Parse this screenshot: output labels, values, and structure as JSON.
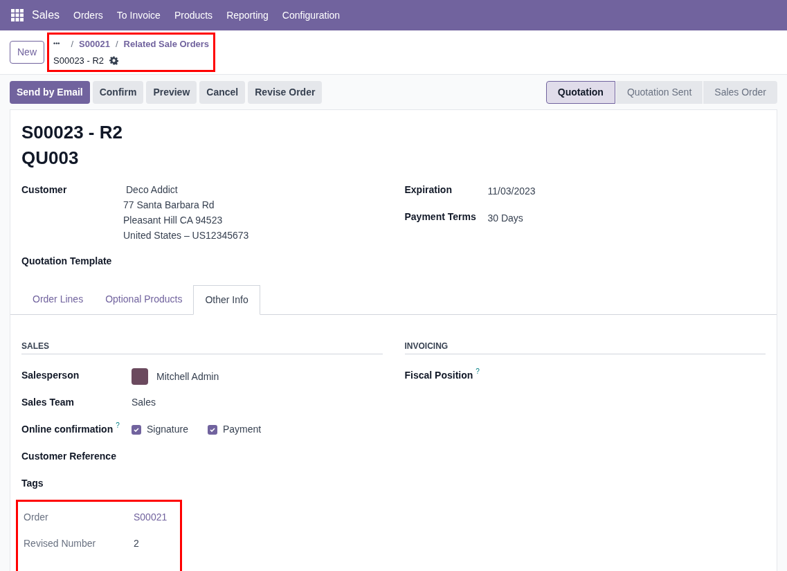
{
  "navbar": {
    "app": "Sales",
    "menu": [
      "Orders",
      "To Invoice",
      "Products",
      "Reporting",
      "Configuration"
    ]
  },
  "control_panel": {
    "new_button": "New",
    "annotated": true,
    "separator": "/",
    "breadcrumbs": [
      "•••",
      "S00021",
      "Related Sale Orders"
    ],
    "current": "S00023 - R2"
  },
  "actions": [
    "Send by Email",
    "Confirm",
    "Preview",
    "Cancel",
    "Revise Order"
  ],
  "statusbar": [
    {
      "label": "Quotation",
      "selected": true
    },
    {
      "label": "Quotation Sent",
      "selected": false
    },
    {
      "label": "Sales Order",
      "selected": false
    }
  ],
  "form": {
    "name": "S00023 - R2",
    "subtitle": "QU003",
    "left_fields": [
      {
        "label": "Customer",
        "lines": [
          "Deco Addict",
          "77 Santa Barbara Rd",
          "Pleasant Hill CA 94523",
          "United States – US12345673"
        ]
      },
      {
        "label": "Quotation Template"
      }
    ],
    "right_fields": [
      {
        "label": "Expiration",
        "lines": [
          "11/03/2023"
        ]
      },
      {
        "label": "Payment Terms",
        "lines": [
          "30 Days"
        ]
      }
    ],
    "tabs": [
      {
        "label": "Order Lines",
        "selected": false
      },
      {
        "label": "Optional Products",
        "selected": false
      },
      {
        "label": "Other Info",
        "selected": true
      }
    ],
    "sales": {
      "title": "SALES",
      "fields": [
        {
          "kind": "user",
          "label": "Salesperson",
          "value": "Mitchell Admin"
        },
        {
          "kind": "text",
          "label": "Sales Team",
          "value": "Sales"
        },
        {
          "kind": "checks",
          "label": "Online confirmation",
          "help": "?",
          "options": [
            {
              "label": "Signature",
              "checked": true
            },
            {
              "label": "Payment",
              "checked": true
            }
          ]
        },
        {
          "kind": "text",
          "label": "Customer Reference"
        },
        {
          "kind": "text",
          "label": "Tags"
        }
      ],
      "annotated": true,
      "extra_fields": [
        {
          "kind": "link",
          "label": "Order",
          "value": "S00021"
        },
        {
          "kind": "text",
          "label": "Revised Number",
          "value": "2"
        }
      ]
    },
    "invoicing": {
      "title": "INVOICING",
      "fields": [
        {
          "label": "Fiscal Position",
          "help": "?"
        }
      ]
    }
  }
}
